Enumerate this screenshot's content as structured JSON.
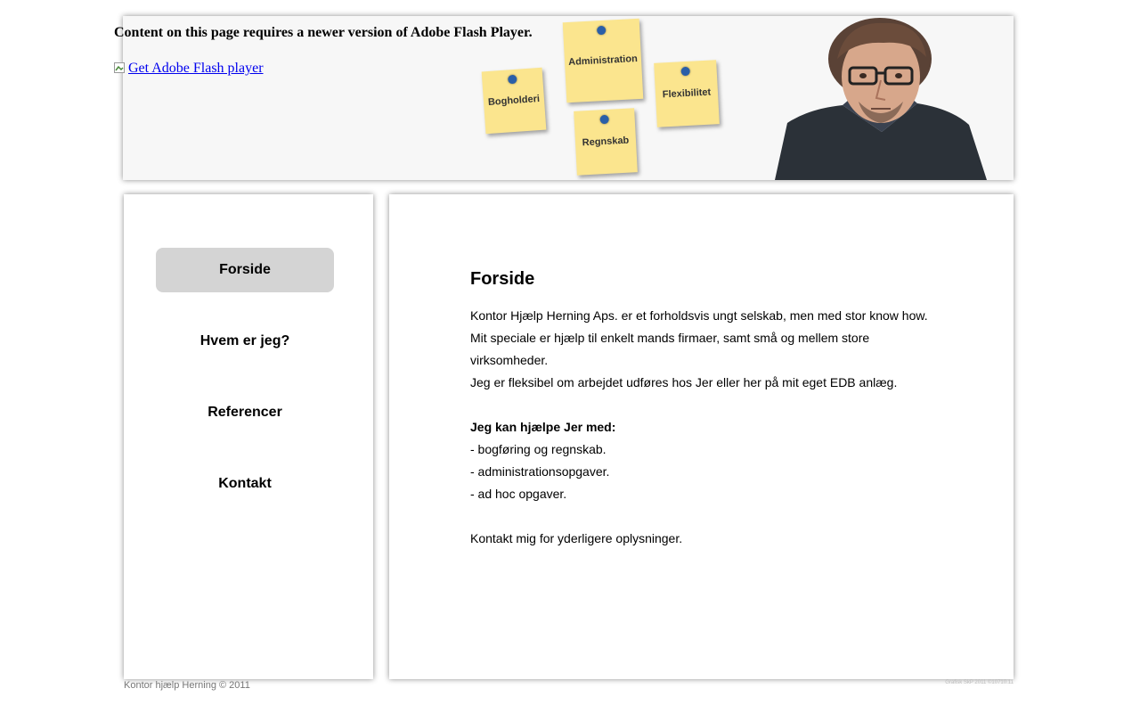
{
  "header": {
    "flash_message": "Content on this page requires a newer version of Adobe Flash Player.",
    "flash_link": "Get Adobe Flash player",
    "notes": [
      "Administration",
      "Bogholderi",
      "Flexibilitet",
      "Regnskab"
    ]
  },
  "nav": {
    "items": [
      {
        "label": "Forside"
      },
      {
        "label": "Hvem er jeg?"
      },
      {
        "label": "Referencer"
      },
      {
        "label": "Kontakt"
      }
    ]
  },
  "content": {
    "title": "Forside",
    "intro": "Kontor Hjælp Herning Aps. er et forholdsvis ungt selskab, men med stor know how. Mit speciale er hjælp til enkelt mands firmaer, samt små og mellem store virksomheder.",
    "flex": "Jeg er fleksibel om arbejdet udføres hos Jer eller her på mit eget EDB anlæg.",
    "help_heading": "Jeg kan hjælpe Jer med:",
    "help_items": [
      "- bogføring og regnskab.",
      "- administrationsopgaver.",
      "- ad hoc opgaver."
    ],
    "contact": "Kontakt mig for yderligere oplysninger."
  },
  "footer": {
    "copyright": "Kontor hjælp Herning © 2011",
    "credit": "Grafisk SkP 2011 ©10710.11"
  }
}
